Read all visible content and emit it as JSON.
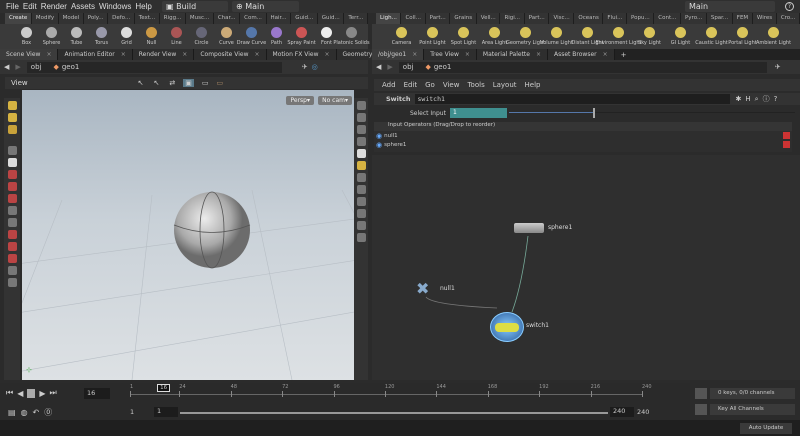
{
  "menubar": {
    "items": [
      "File",
      "Edit",
      "Render",
      "Assets",
      "Windows",
      "Help"
    ],
    "desktop": "Build",
    "context": "Main",
    "right_context": "Main"
  },
  "left_shelf": {
    "tabs": [
      "Create",
      "Modify",
      "Model",
      "Poly...",
      "Defo...",
      "Text...",
      "Rigg...",
      "Musc...",
      "Char...",
      "Com...",
      "Hair...",
      "Guid...",
      "Guid...",
      "Terr..."
    ],
    "tools": [
      "Box",
      "Sphere",
      "Tube",
      "Torus",
      "Grid",
      "Null",
      "Line",
      "Circle",
      "Curve",
      "Draw Curve",
      "Path",
      "Spray Paint",
      "Font",
      "Platonic Solids"
    ]
  },
  "right_shelf": {
    "tabs": [
      "Ligh...",
      "Coll...",
      "Part...",
      "Grains",
      "Vell...",
      "Rigi...",
      "Part...",
      "Visc...",
      "Oceans",
      "Flui...",
      "Popu...",
      "Cont...",
      "Pyro...",
      "Spar...",
      "FEM",
      "Wires",
      "Cro..."
    ],
    "tools": [
      "Camera",
      "Point Light",
      "Spot Light",
      "Area Light",
      "Geometry Light",
      "Volume Light",
      "Distant Light",
      "Environment Light",
      "Sky Light",
      "GI Light",
      "Caustic Light",
      "Portal Light",
      "Ambient Light"
    ]
  },
  "left_pane": {
    "tabs": [
      "Scene View",
      "Animation Editor",
      "Render View",
      "Composite View",
      "Motion FX View",
      "Geometry Sprea..."
    ],
    "path": [
      "obj",
      "geo1"
    ],
    "view_label": "View",
    "persp": "Persp▾",
    "cam": "No cam▾"
  },
  "right_pane": {
    "tabs": [
      "/obj/geo1",
      "Tree View",
      "Material Palette",
      "Asset Browser"
    ],
    "path": [
      "obj",
      "geo1"
    ],
    "menu": [
      "Add",
      "Edit",
      "Go",
      "View",
      "Tools",
      "Layout",
      "Help"
    ],
    "params": {
      "node_type": "Switch",
      "node_name": "switch1",
      "select_input_label": "Select Input",
      "select_input_value": "1",
      "select_input_fraction": 0.3,
      "list_header": "Input Operators (Drag/Drop to reorder)",
      "inputs": [
        "null1",
        "sphere1"
      ]
    },
    "nodes": {
      "sphere": "sphere1",
      "null": "null1",
      "switch": "switch1"
    }
  },
  "timeline": {
    "current_frame": "16",
    "ticks": [
      "1",
      "24",
      "48",
      "72",
      "96",
      "120",
      "144",
      "168",
      "192",
      "216",
      "240"
    ],
    "start": "1",
    "start2": "1",
    "end": "240",
    "end2": "240",
    "keys": "0 keys, 0/0 channels",
    "key_all": "Key All Channels",
    "auto_update": "Auto Update"
  }
}
